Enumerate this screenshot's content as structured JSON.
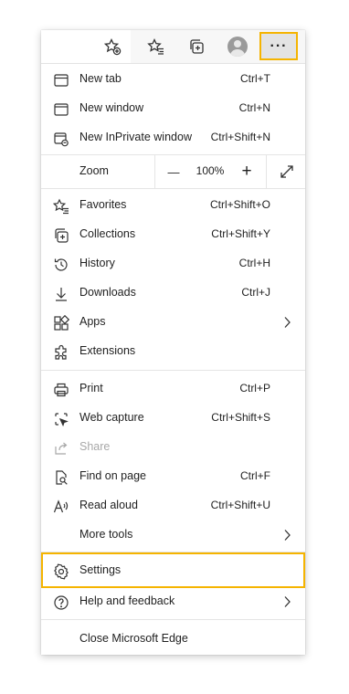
{
  "toolbar": {
    "more_label": "···",
    "icons": [
      "add-favorite-icon",
      "favorites-icon",
      "collections-icon",
      "profile-avatar",
      "more-icon"
    ]
  },
  "menu": {
    "new_tab": {
      "label": "New tab",
      "shortcut": "Ctrl+T"
    },
    "new_window": {
      "label": "New window",
      "shortcut": "Ctrl+N"
    },
    "new_inprivate": {
      "label": "New InPrivate window",
      "shortcut": "Ctrl+Shift+N"
    },
    "zoom": {
      "label": "Zoom",
      "minus": "—",
      "value": "100%",
      "plus": "+"
    },
    "favorites": {
      "label": "Favorites",
      "shortcut": "Ctrl+Shift+O"
    },
    "collections": {
      "label": "Collections",
      "shortcut": "Ctrl+Shift+Y"
    },
    "history": {
      "label": "History",
      "shortcut": "Ctrl+H"
    },
    "downloads": {
      "label": "Downloads",
      "shortcut": "Ctrl+J"
    },
    "apps": {
      "label": "Apps"
    },
    "extensions": {
      "label": "Extensions"
    },
    "print": {
      "label": "Print",
      "shortcut": "Ctrl+P"
    },
    "web_capture": {
      "label": "Web capture",
      "shortcut": "Ctrl+Shift+S"
    },
    "share": {
      "label": "Share"
    },
    "find_on_page": {
      "label": "Find on page",
      "shortcut": "Ctrl+F"
    },
    "read_aloud": {
      "label": "Read aloud",
      "shortcut": "Ctrl+Shift+U"
    },
    "more_tools": {
      "label": "More tools"
    },
    "settings": {
      "label": "Settings"
    },
    "help": {
      "label": "Help and feedback"
    },
    "close_edge": {
      "label": "Close Microsoft Edge"
    }
  },
  "colors": {
    "highlight": "#f5b400",
    "text": "#1f1f1f",
    "disabled": "#a8a8a8"
  }
}
